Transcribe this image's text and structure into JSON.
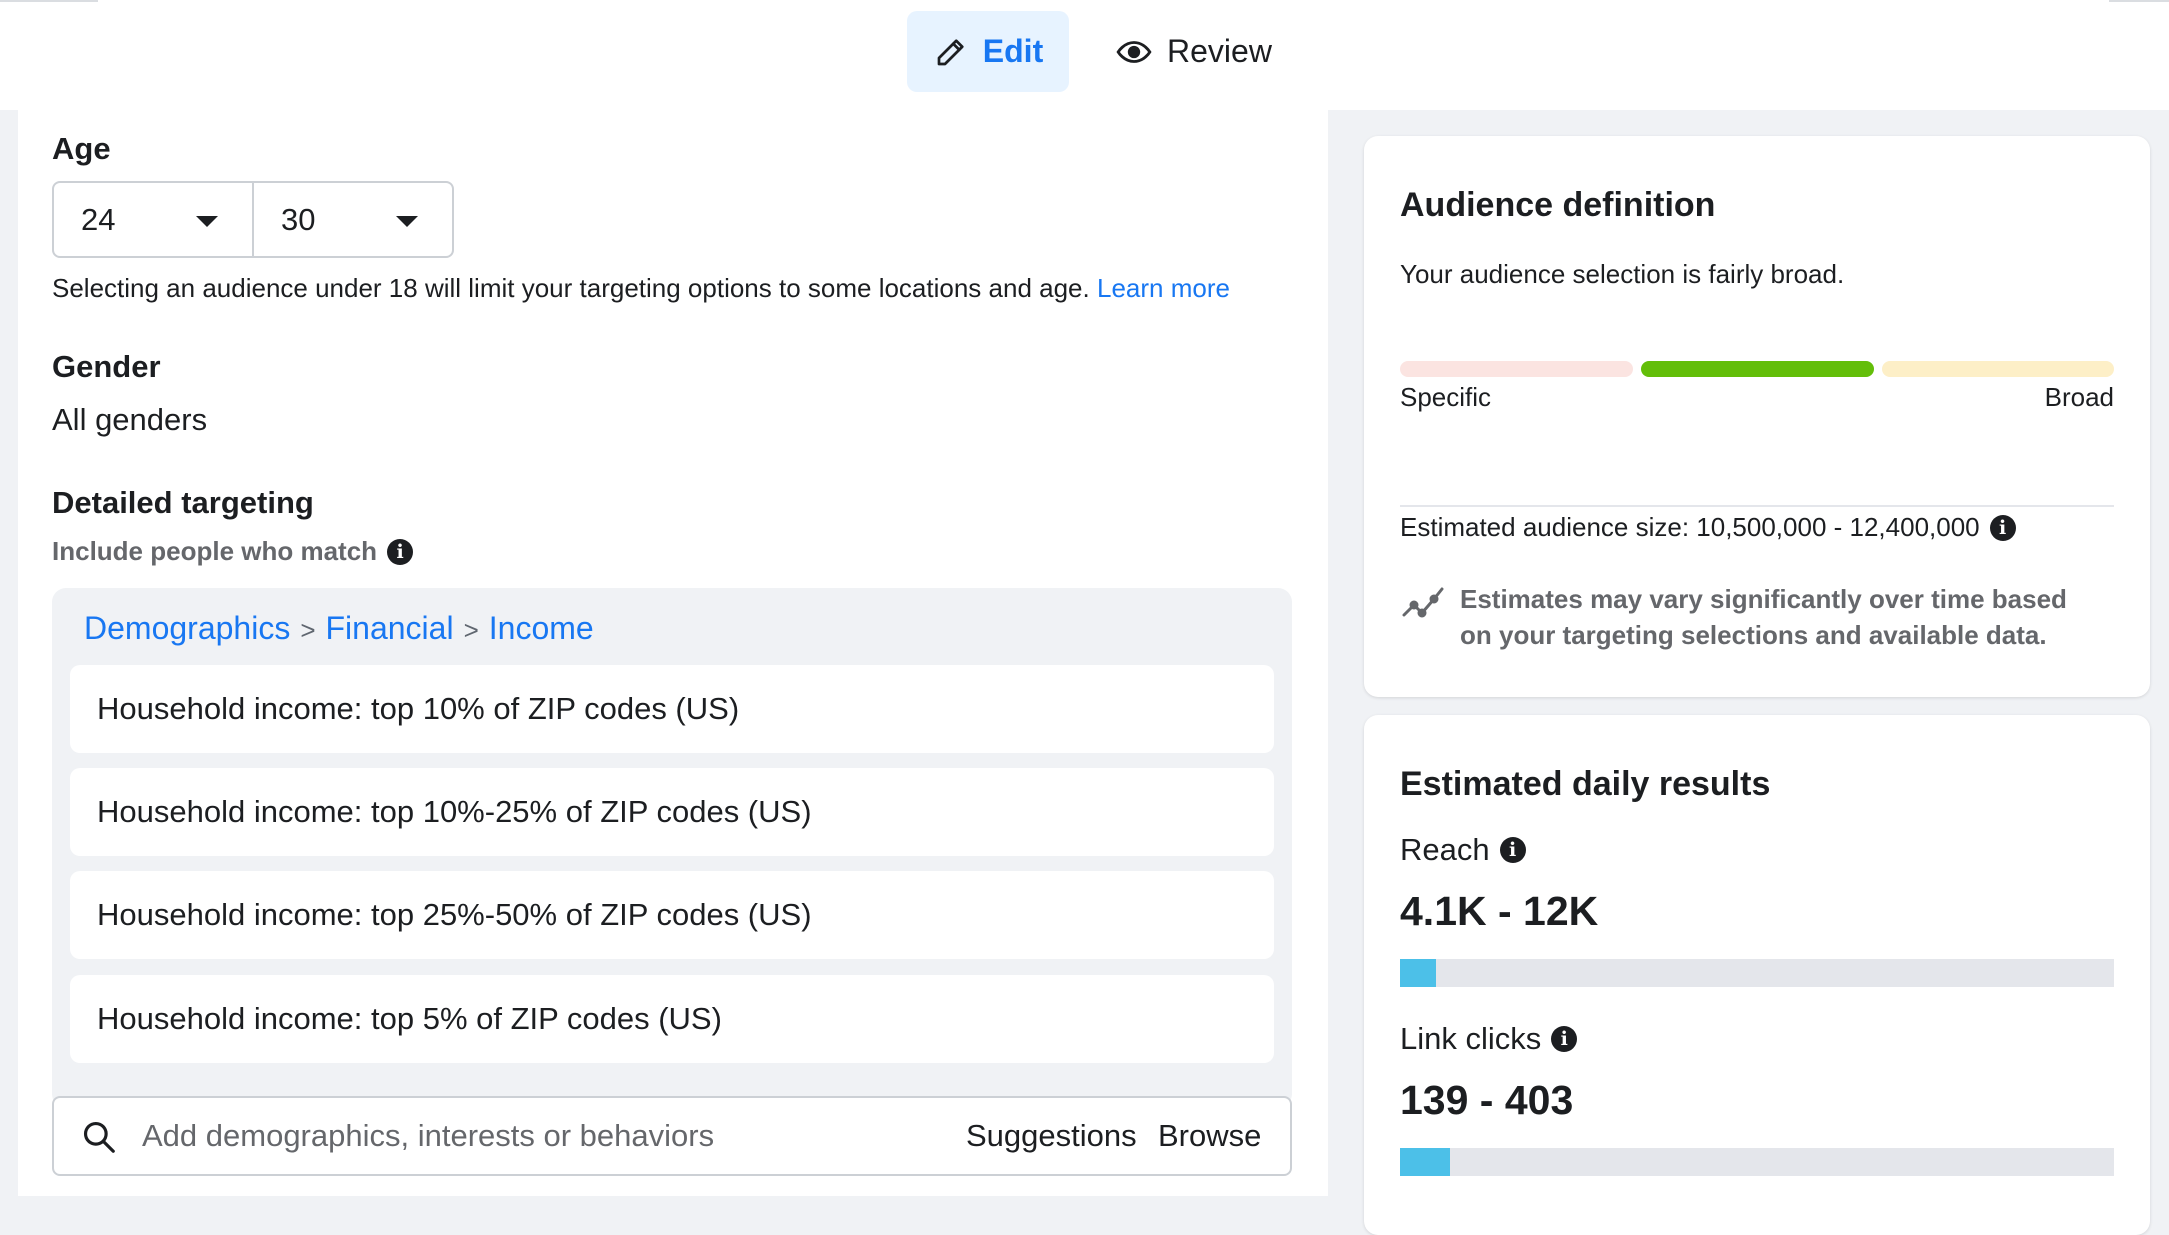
{
  "tabs": {
    "edit": "Edit",
    "review": "Review"
  },
  "age": {
    "label": "Age",
    "min": "24",
    "max": "30",
    "note": "Selecting an audience under 18 will limit your targeting options to some locations and age.",
    "learn_more": "Learn more"
  },
  "gender": {
    "label": "Gender",
    "value": "All genders"
  },
  "detailed_targeting": {
    "label": "Detailed targeting",
    "include_label": "Include people who match",
    "breadcrumb": [
      "Demographics",
      "Financial",
      "Income"
    ],
    "breadcrumb_sep": ">",
    "items": [
      "Household income: top 10% of ZIP codes (US)",
      "Household income: top 10%-25% of ZIP codes (US)",
      "Household income: top 25%-50% of ZIP codes (US)",
      "Household income: top 5% of ZIP codes (US)"
    ],
    "search_placeholder": "Add demographics, interests or behaviors",
    "suggestions": "Suggestions",
    "browse": "Browse"
  },
  "audience_definition": {
    "title": "Audience definition",
    "summary": "Your audience selection is fairly broad.",
    "gauge_segments": [
      {
        "state": "inactive",
        "color": "#fbe4e1"
      },
      {
        "state": "active",
        "color": "#63be09"
      },
      {
        "state": "inactive",
        "color": "#fdefc7"
      }
    ],
    "specific_label": "Specific",
    "broad_label": "Broad",
    "size_text": "Estimated audience size: 10,500,000 - 12,400,000",
    "warning": "Estimates may vary significantly over time based on your targeting selections and available data."
  },
  "daily_results": {
    "title": "Estimated daily results",
    "reach_label": "Reach",
    "reach_value": "4.1K - 12K",
    "reach_fraction": 0.05,
    "clicks_label": "Link clicks",
    "clicks_value": "139 - 403",
    "clicks_fraction": 0.07,
    "bar_color": "#4cc0e8"
  },
  "colors": {
    "accent": "#1877f2",
    "text": "#1c1e21",
    "muted": "#65676b",
    "background": "#f0f2f5"
  }
}
